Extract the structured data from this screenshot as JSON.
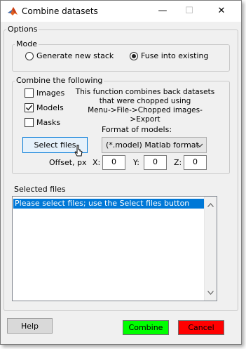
{
  "window": {
    "title": "Combine datasets",
    "minimize": "—",
    "maximize": "☐",
    "close": "✕"
  },
  "options": {
    "legend": "Options",
    "mode": {
      "legend": "Mode",
      "generate_label": "Generate new stack",
      "fuse_label": "Fuse into existing",
      "selected": "fuse"
    },
    "combine": {
      "legend": "Combine the following",
      "images_label": "Images",
      "models_label": "Models",
      "masks_label": "Masks",
      "images_checked": false,
      "models_checked": true,
      "masks_checked": false,
      "info_line1": "This function combines back datasets",
      "info_line2": "that were chopped using",
      "info_line3": "Menu->File->Chopped images->Export",
      "format_label": "Format of models:",
      "format_value": "(*.model) Matlab format",
      "select_files_label": "Select files",
      "offset_label": "Offset, px",
      "x_label": "X:",
      "y_label": "Y:",
      "z_label": "Z:",
      "x_value": "0",
      "y_value": "0",
      "z_value": "0"
    }
  },
  "selected_files": {
    "label": "Selected files",
    "items": [
      "Please select files; use the Select files button"
    ]
  },
  "footer": {
    "help_label": "Help",
    "combine_label": "Combine",
    "cancel_label": "Cancel"
  },
  "colors": {
    "combine": "#00ff00",
    "cancel": "#ff0000",
    "selection": "#0078d7"
  }
}
